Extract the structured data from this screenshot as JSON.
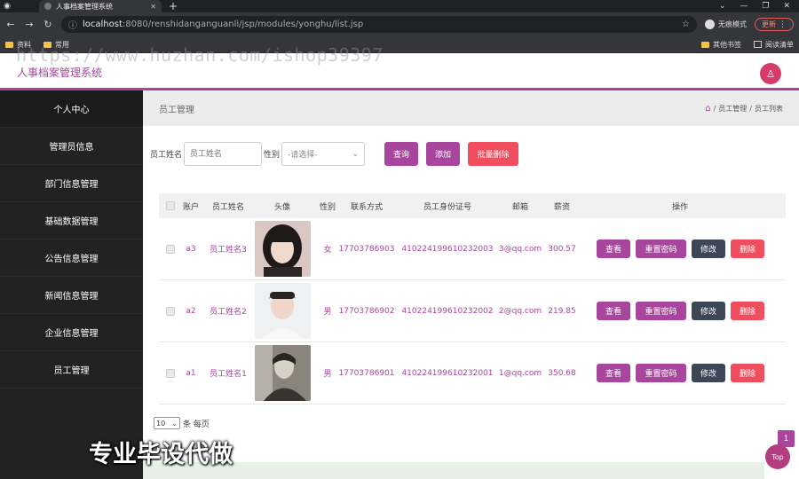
{
  "browser": {
    "tab_title": "人事档案管理系统",
    "url_host": "localhost",
    "url_rest": ":8080/renshidanganguanli/jsp/modules/yonghu/list.jsp",
    "incognito_label": "无痕模式",
    "update_label": "更新",
    "bookmarks": [
      "资料",
      "常用"
    ],
    "bookmarks_right": [
      "其他书签",
      "阅读清单"
    ]
  },
  "watermark": "https://www.huzhan.com/ishop39397",
  "app": {
    "title": "人事档案管理系统"
  },
  "sidebar": {
    "items": [
      {
        "label": "个人中心"
      },
      {
        "label": "管理员信息"
      },
      {
        "label": "部门信息管理"
      },
      {
        "label": "基础数据管理"
      },
      {
        "label": "公告信息管理"
      },
      {
        "label": "新闻信息管理"
      },
      {
        "label": "企业信息管理"
      },
      {
        "label": "员工管理"
      }
    ]
  },
  "page": {
    "title": "员工管理",
    "breadcrumb": [
      "员工管理",
      "员工列表"
    ]
  },
  "search": {
    "name_label": "员工姓名",
    "name_placeholder": "员工姓名",
    "gender_label": "性别",
    "gender_selected": "-请选择-",
    "query_btn": "查询",
    "add_btn": "添加",
    "batch_delete_btn": "批量删除"
  },
  "table": {
    "headers": {
      "account": "账户",
      "name": "员工姓名",
      "avatar": "头像",
      "gender": "性别",
      "phone": "联系方式",
      "id_number": "员工身份证号",
      "email": "邮箱",
      "salary": "薪资",
      "actions": "操作"
    },
    "actions": {
      "view": "查看",
      "reset": "重置密码",
      "edit": "修改",
      "delete": "删除"
    },
    "rows": [
      {
        "account": "a3",
        "name": "员工姓名3",
        "gender": "女",
        "phone": "17703786903",
        "id_number": "410224199610232003",
        "email": "3@qq.com",
        "salary": "300.57"
      },
      {
        "account": "a2",
        "name": "员工姓名2",
        "gender": "男",
        "phone": "17703786902",
        "id_number": "410224199610232002",
        "email": "2@qq.com",
        "salary": "219.85"
      },
      {
        "account": "a1",
        "name": "员工姓名1",
        "gender": "男",
        "phone": "17703786901",
        "id_number": "410224199610232001",
        "email": "1@qq.com",
        "salary": "350.68"
      }
    ]
  },
  "pager": {
    "page_size": "10",
    "per_page_label": "条 每页",
    "current_page": "1"
  },
  "top_button": "Top",
  "overlay_caption": "专业毕设代做",
  "colors": {
    "accent": "#a8469e",
    "danger": "#f04e5e",
    "dark": "#3c4656",
    "sidebar": "#222222"
  }
}
